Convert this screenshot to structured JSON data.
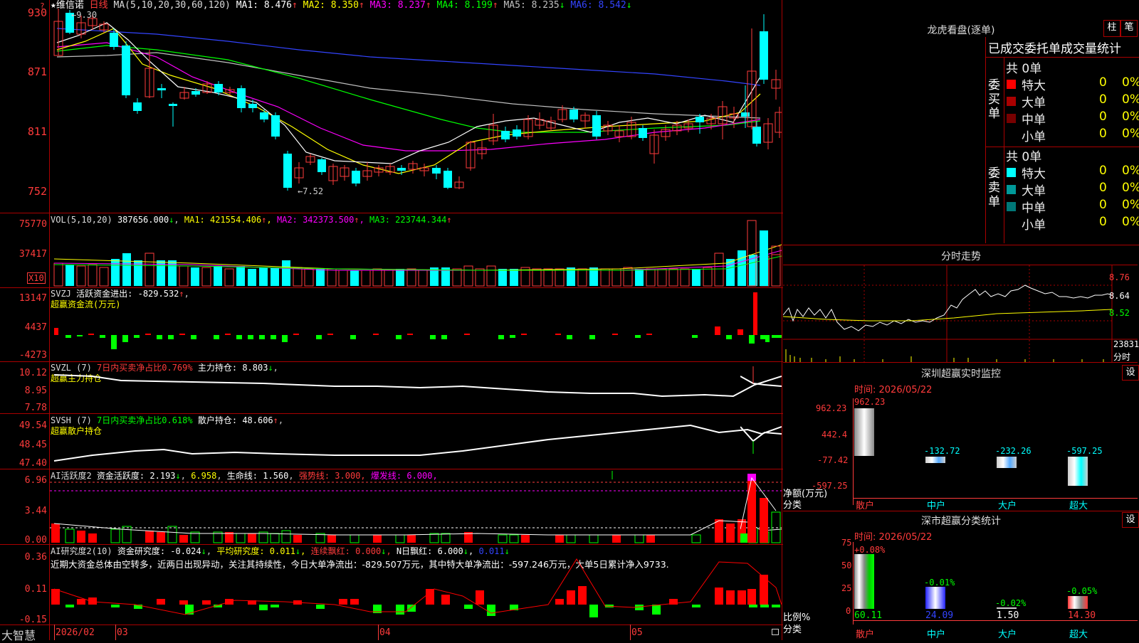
{
  "stock": {
    "name": "维信诺",
    "period": "日线",
    "star": "★",
    "qmark": "?"
  },
  "price": {
    "ma_header": "MA(5,10,20,30,60,120)",
    "ma": [
      {
        "label": "MA1:",
        "value": "8.476",
        "arrow": "↑",
        "color": "#ffffff"
      },
      {
        "label": "MA2:",
        "value": "8.350",
        "arrow": "↑",
        "color": "#ffff00"
      },
      {
        "label": "MA3:",
        "value": "8.237",
        "arrow": "↑",
        "color": "#ff00ff"
      },
      {
        "label": "MA4:",
        "value": "8.199",
        "arrow": "↑",
        "color": "#00ff00"
      },
      {
        "label": "MA5:",
        "value": "8.235",
        "arrow": "↓",
        "color": "#c0c0c0"
      },
      {
        "label": "MA6:",
        "value": "8.542",
        "arrow": "↓",
        "color": "#3333ff"
      }
    ],
    "axis": [
      "930",
      "871",
      "811",
      "752"
    ],
    "high_note": "9.30",
    "low_note": "7.52"
  },
  "vol": {
    "header": "VOL(5,10,20)",
    "value": "387656.000",
    "ma1": "421554.406",
    "ma2": "342373.500",
    "ma3": "223744.344",
    "axis": [
      "75770",
      "37417"
    ],
    "unit": "X10"
  },
  "svzj": {
    "name": "SVZJ",
    "label": "活跃资金进出:",
    "value": "-829.532",
    "arrow": "↑",
    "sub": "超赢资金流(万元)",
    "axis": [
      "13147",
      "4437",
      "-4273"
    ]
  },
  "svzl": {
    "name": "SVZL (7)",
    "label1": "7日内买卖净占比0.769%",
    "label2": "主力持仓:",
    "value": "8.803",
    "arrow": "↓",
    "sub": "超赢主力持仓",
    "axis": [
      "10.12",
      "8.95",
      "7.78"
    ]
  },
  "svsh": {
    "name": "SVSH (7)",
    "label1": "7日内买卖净占比0.618%",
    "label2": "散户持仓:",
    "value": "48.606",
    "arrow": "↑",
    "sub": "超赢散户持仓",
    "axis": [
      "49.54",
      "48.45",
      "47.40"
    ]
  },
  "ai1": {
    "name": "AI活跃度2",
    "label": "资金活跃度:",
    "value": "2.193",
    "arrow": "↓",
    "v2": "6.958",
    "life_label": "生命线:",
    "life": "1.560",
    "strong": "强势线:",
    "strong_v": "3.000",
    "burst": "爆发线:",
    "burst_v": "6.000",
    "axis": [
      "6.96",
      "3.44",
      "0.00"
    ]
  },
  "ai2": {
    "name": "AI研究度2(10)",
    "label": "资金研究度:",
    "value": "-0.024",
    "avg_label": "平均研究度:",
    "avg": "0.011",
    "lian_label": "连续飘红:",
    "lian": "0.000",
    "n_label": "N日飘红:",
    "n": "6.000",
    "last": "0.011",
    "axis": [
      "0.36",
      "0.11",
      "-0.15"
    ],
    "commentary": "近期大资金总体由空转多，近两日出现异动，关注其持续性，今日大单净流出：-829.507万元，其中特大单净流出：-597.246万元，大单5日累计净入9733."
  },
  "xaxis": {
    "brand": "大智慧",
    "labels": [
      "2026/02",
      "03",
      "04",
      "05"
    ]
  },
  "longhu": {
    "title": "龙虎看盘(逐单)",
    "btn1": "柱",
    "btn2": "笔",
    "subtitle": "已成交委托单成交量统计",
    "buy": {
      "side": "委买单",
      "total": "共 0单",
      "rows": [
        {
          "name": "特大",
          "count": "0",
          "pct": "0%",
          "color": "#ff0000"
        },
        {
          "name": "大单",
          "count": "0",
          "pct": "0%",
          "color": "#aa0000"
        },
        {
          "name": "中单",
          "count": "0",
          "pct": "0%",
          "color": "#770000"
        },
        {
          "name": "小单",
          "count": "0",
          "pct": "0%",
          "color": "#000000"
        }
      ]
    },
    "sell": {
      "side": "委卖单",
      "total": "共 0单",
      "rows": [
        {
          "name": "特大",
          "count": "0",
          "pct": "0%",
          "color": "#00ffff"
        },
        {
          "name": "大单",
          "count": "0",
          "pct": "0%",
          "color": "#009999"
        },
        {
          "name": "中单",
          "count": "0",
          "pct": "0%",
          "color": "#007777"
        },
        {
          "name": "小单",
          "count": "0",
          "pct": "0%",
          "color": "#000000"
        }
      ]
    }
  },
  "intraday": {
    "title": "分时走势",
    "axis": [
      "8.76",
      "8.64",
      "8.52"
    ],
    "vol": "23831",
    "vol_label": "分时"
  },
  "monitor": {
    "title": "深圳超赢实时监控",
    "btn": "设",
    "time": "时间: 2026/05/22",
    "axis": [
      "962.23",
      "442.4",
      "-77.42",
      "-597.25"
    ],
    "ylabel": "净额(万元)",
    "xlabel": "分类",
    "cats": [
      "散户",
      "中户",
      "大户",
      "超大"
    ],
    "values": [
      "962.23",
      "-132.72",
      "-232.26",
      "-597.25"
    ]
  },
  "classify": {
    "title": "深市超赢分类统计",
    "btn": "设",
    "time": "时间: 2026/05/22",
    "axis": [
      "75",
      "50",
      "25",
      "0"
    ],
    "ylabel": "比例%",
    "xlabel": "分类",
    "cats": [
      "散户",
      "中户",
      "大户",
      "超大"
    ],
    "pcts": [
      "60.11",
      "24.09",
      "1.50",
      "14.30"
    ],
    "changes": [
      "+0.08%",
      "-0.01%",
      "-0.02%",
      "-0.05%"
    ]
  }
}
